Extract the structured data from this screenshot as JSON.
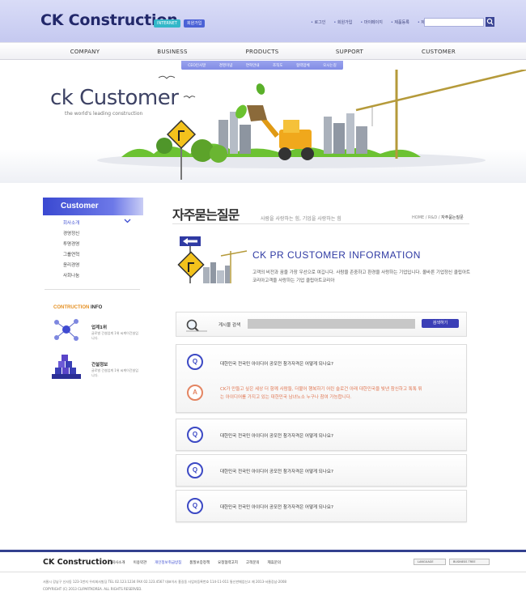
{
  "header": {
    "logo": "CK Construction",
    "badges": [
      "INTERNET",
      "회원가입"
    ],
    "utility_links": [
      "로그인",
      "회원가입",
      "마이페이지",
      "제품등록",
      "제품검색"
    ],
    "search_button_icon": "search-icon"
  },
  "nav": {
    "items": [
      "COMPANY",
      "BUSINESS",
      "PRODUCTS",
      "SUPPORT",
      "CUSTOMER"
    ],
    "subitems": [
      "CEO인사말",
      "경영이념",
      "연혁안내",
      "조직도",
      "협력업체",
      "오시는길"
    ]
  },
  "hero": {
    "title": "ck Customer",
    "subtitle": "the world's leading construction"
  },
  "sidebar": {
    "heading": "Customer",
    "items": [
      "회사소개",
      "경영정신",
      "투명경영",
      "그룹연혁",
      "윤리경영",
      "사회나눔"
    ],
    "info_title_a": "CONTRUCTION",
    "info_title_b": " INFO",
    "info": [
      {
        "name": "업계1위",
        "desc": "글로벌 건설업계 1위 씨케이건설입니다."
      },
      {
        "name": "건설정보",
        "desc": "글로벌 건설업계 1위 씨케이건설입니다."
      }
    ]
  },
  "main": {
    "title": "자주묻는질문",
    "subtitle": "사람을 사랑하는 힘, 기업을 사랑하는 힘",
    "breadcrumb_path": "HOME / R&D / ",
    "breadcrumb_current": "자주묻는질문",
    "pr_title": "CK PR CUSTOMER INFORMATION",
    "pr_text": "고객의 비전과 꿈을 가장 우선으로 여깁니다. 사람을 존중하고 환경을 사랑하는 기업입니다. 올바른 기업정신 클립아트코리아고객을 사랑하는 기업 클립아트코리아",
    "search_label": "게시물 검색",
    "search_button": "검색하기",
    "q_badge": "Q",
    "a_badge": "A",
    "faqs": [
      {
        "question": "대한민국 전국민 아이디어 공모전 참가자격은 어떻게 되나요?",
        "answer": "CK가 만들고 싶은 세상 더 함께 사람들, 더불어 행복하기 어린 슬로건 아래 대한민국을 빛낸 참신하고 톡톡 튀는 아이디어를 가지고 있는 대한민국 남녀노소 누구나 참여 가능합니다."
      },
      {
        "question": "대한민국 전국민 아이디어 공모전 참가자격은 어떻게 되나요?"
      },
      {
        "question": "대한민국 전국민 아이디어 공모전 참가자격은 어떻게 되나요?"
      },
      {
        "question": "대한민국 전국민 아이디어 공모전 참가자격은 어떻게 되나요?"
      }
    ]
  },
  "footer": {
    "logo": "CK Construction",
    "links": [
      "회사소개",
      "이용약관",
      "개인정보취급방침",
      "품질보증정책",
      "요청협력고지",
      "고객문의",
      "제휴문의"
    ],
    "selects": [
      "LANGUAGE",
      "BUSINESS TREE"
    ],
    "address": "서울시 강남구 신사동 123-1번지 우리회사빌딩 TEL 02.123.1234 FAX 02.123.4567 대표이사 홍길동 사업자등록번호 114-11-011 통신판매업신고 제 2013-서울강남-2008",
    "copyright": "COPYRIGHT (C) 2013 CLIPARTKOREA. ALL RIGHTS RESERVED."
  },
  "colors": {
    "brand": "#2f3aa3",
    "accent_orange": "#e48562",
    "header_bg": "#c9cdf2"
  }
}
